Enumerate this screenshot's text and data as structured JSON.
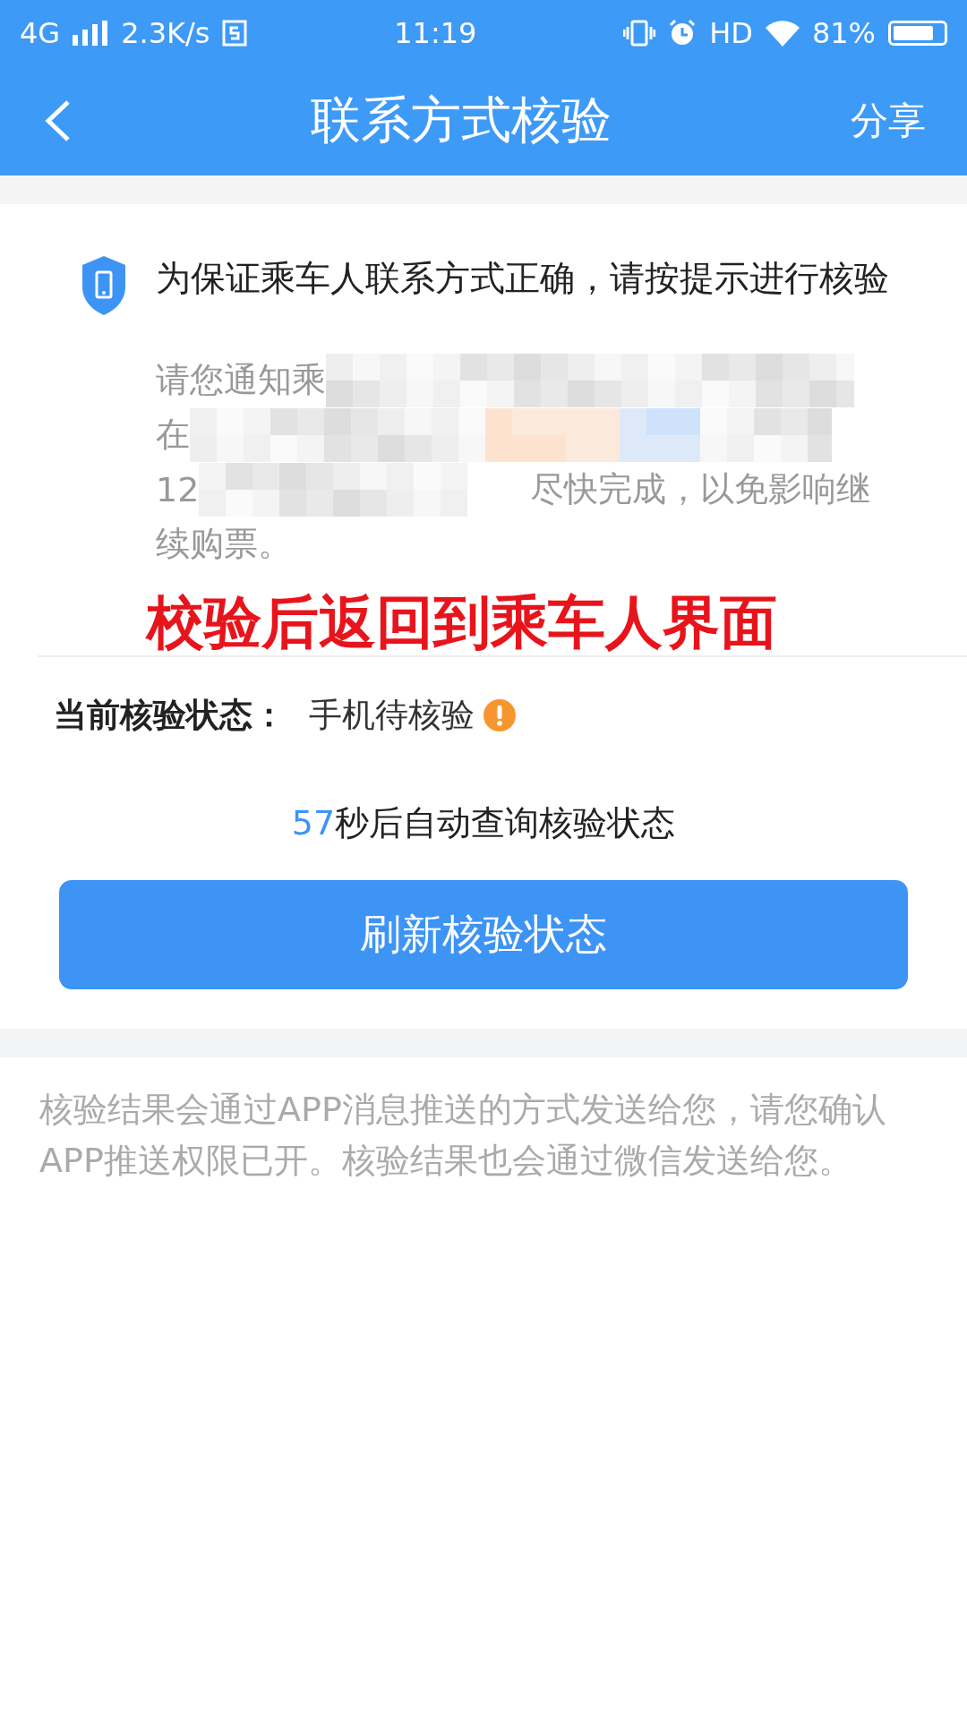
{
  "status_bar": {
    "network": "4G",
    "speed": "2.3K/s",
    "time": "11:19",
    "hd": "HD",
    "battery": "81%"
  },
  "nav": {
    "title": "联系方式核验",
    "action": "分享"
  },
  "notice": {
    "text": "为保证乘车人联系方式正确，请按提示进行核验"
  },
  "instruction_lines": [
    {
      "kind": "masked",
      "before": "请您通知乘"
    },
    {
      "kind": "masked",
      "before": "在"
    },
    {
      "kind": "masked",
      "before": "12",
      "after": "尽快完成，以免影响继"
    },
    {
      "kind": "plain",
      "before": "续购票。"
    }
  ],
  "annotation": "校验后返回到乘车人界面",
  "verify_status": {
    "label": "当前核验状态：",
    "value": "手机待核验"
  },
  "countdown": {
    "seconds": "57",
    "text": "秒后自动查询核验状态"
  },
  "refresh_button": "刷新核验状态",
  "footer_note": "核验结果会通过APP消息推送的方式发送给您，请您确认APP推送权限已开。核验结果也会通过微信发送给您。"
}
